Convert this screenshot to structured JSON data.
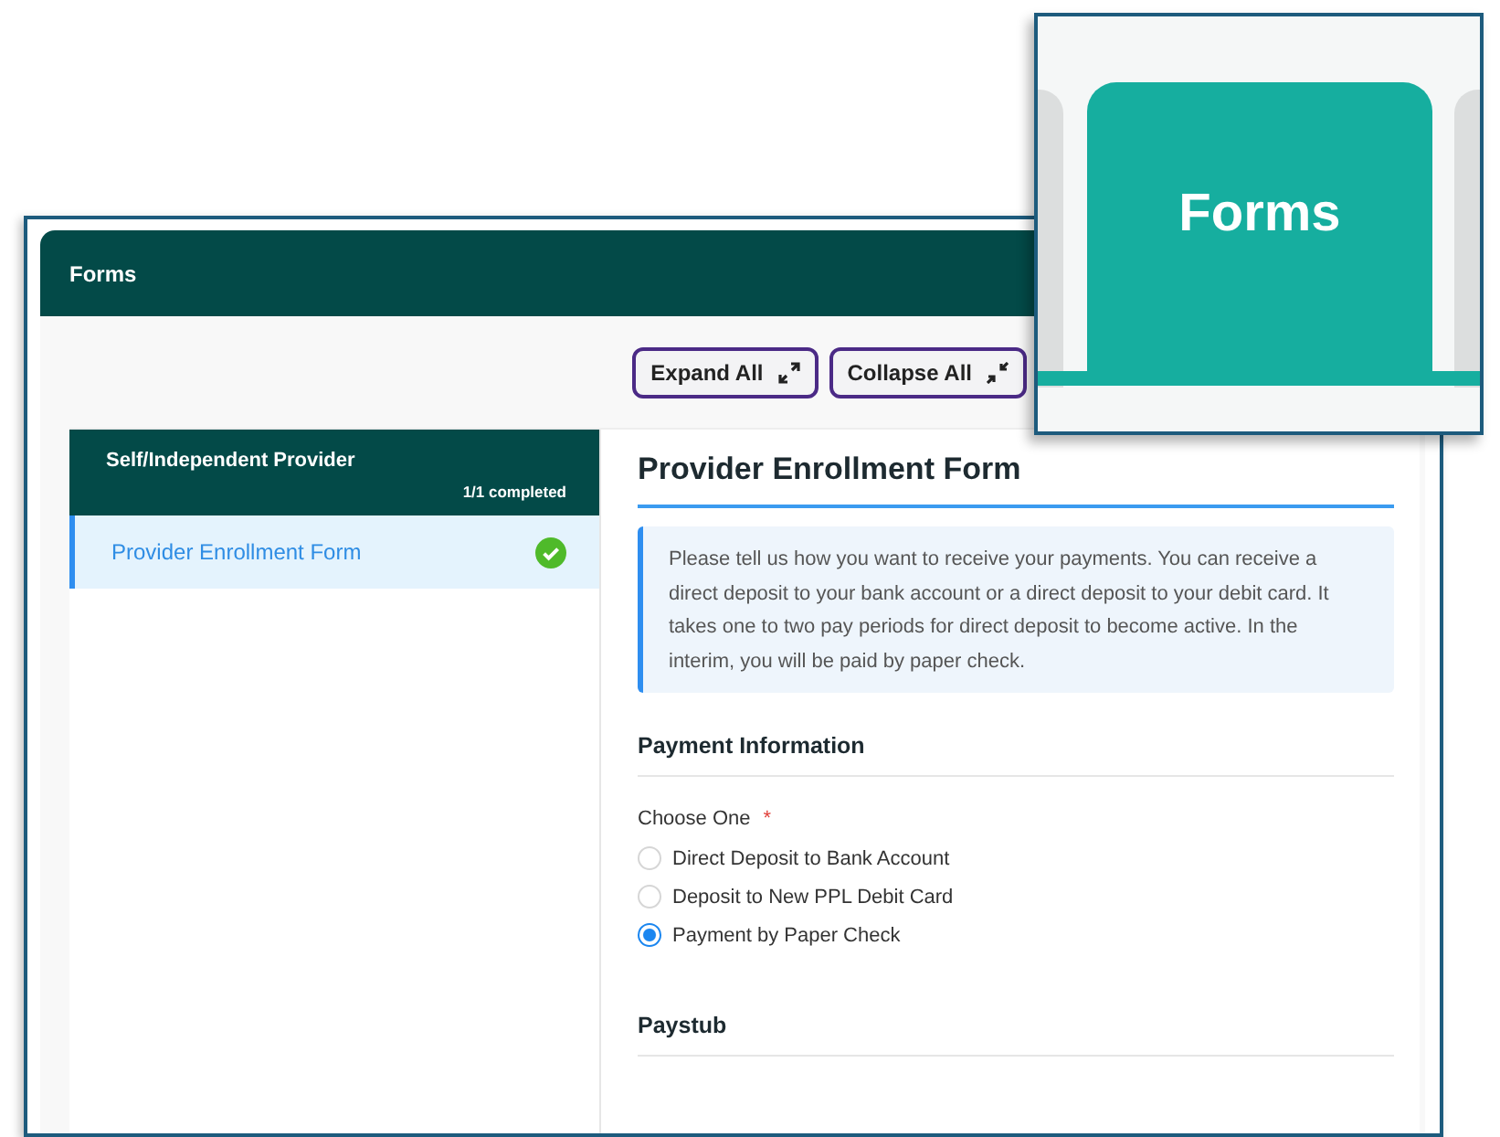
{
  "window": {
    "title": "Forms"
  },
  "toolbar": {
    "buttons": [
      {
        "label": "Expand All",
        "kind": "expand"
      },
      {
        "label": "Collapse All",
        "kind": "collapse"
      }
    ]
  },
  "sidebar": {
    "group": "Self/Independent Provider",
    "progress": "1/1 completed",
    "items": [
      {
        "label": "Provider Enrollment Form",
        "selected": true,
        "completed": true
      }
    ]
  },
  "form": {
    "title": "Provider Enrollment Form",
    "notice": "Please tell us how you want to receive your payments. You can receive a direct deposit to your bank account or a direct deposit to your debit card. It takes one to two pay periods for direct deposit to become active. In the interim, you will be paid by paper check.",
    "sections": [
      {
        "title": "Payment Information",
        "question": {
          "label": "Choose One",
          "required": true,
          "required_mark": "*",
          "options": [
            {
              "label": "Direct Deposit to Bank Account",
              "selected": false
            },
            {
              "label": "Deposit to New PPL Debit Card",
              "selected": false
            },
            {
              "label": "Payment by Paper Check",
              "selected": true
            }
          ]
        }
      },
      {
        "title": "Paystub"
      }
    ]
  },
  "callout": {
    "tab": {
      "label": "Forms",
      "selected": true
    }
  }
}
